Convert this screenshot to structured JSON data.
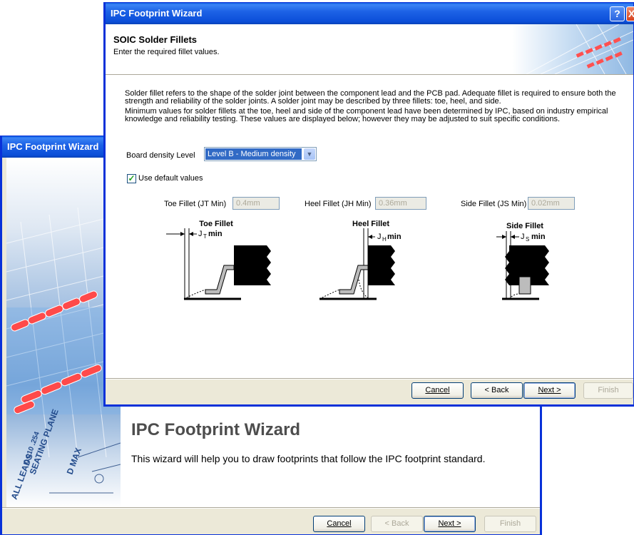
{
  "back_window": {
    "title": "IPC Footprint Wizard",
    "heading": "IPC Footprint Wizard",
    "description": "This wizard will help you to draw footprints that follow the IPC footprint standard.",
    "buttons": {
      "cancel": "Cancel",
      "back": "< Back",
      "next": "Next >",
      "finish": "Finish"
    },
    "banner_text": [
      "SEATING PLANE",
      "ALL LEADS",
      "0.010 .254",
      "D MAX"
    ]
  },
  "front_window": {
    "title": "IPC Footprint Wizard",
    "page_title": "SOIC Solder Fillets",
    "page_subtitle": "Enter the required fillet values.",
    "help_icon": "?",
    "close_icon": "X",
    "paragraph1": "Solder fillet refers to the shape of the solder joint between the component lead and the PCB pad. Adequate fillet is required to ensure both the strength and reliability of the solder joints. A solder joint may be described by three fillets: toe, heel, and side.",
    "paragraph2": "Minimum values for solder fillets at the toe, heel and side of the component lead have been determined by IPC, based on industry empirical knowledge and reliability testing. These values are displayed below; however they may be adjusted to suit specific conditions.",
    "density_label": "Board density Level",
    "density_value": "Level B - Medium density",
    "use_default_label": "Use default values",
    "use_default_checked": true,
    "toe_label": "Toe Fillet (JT Min)",
    "toe_value": "0.4mm",
    "heel_label": "Heel Fillet (JH Min)",
    "heel_value": "0.36mm",
    "side_label": "Side Fillet (JS Min)",
    "side_value": "0.02mm",
    "diagrams": {
      "toe_title": "Toe Fillet",
      "toe_j": "J",
      "toe_sub": "T",
      "heel_title": "Heel Fillet",
      "heel_j": "J",
      "heel_sub": "H",
      "side_title": "Side Fillet",
      "side_j": "J",
      "side_sub": "S",
      "min": "min"
    },
    "buttons": {
      "cancel": "Cancel",
      "back": "< Back",
      "next": "Next >",
      "finish": "Finish"
    }
  }
}
